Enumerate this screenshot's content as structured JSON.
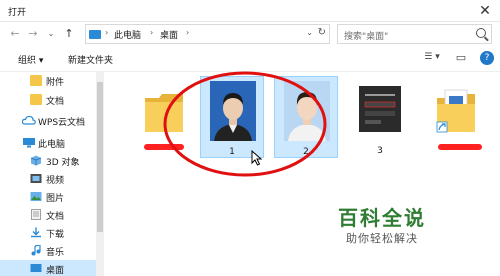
{
  "window": {
    "title": "打开",
    "close_glyph": "✕"
  },
  "nav": {
    "back": "←",
    "forward": "→",
    "dropdown": "⌄",
    "up": "↑"
  },
  "address": {
    "crumbs": [
      "此电脑",
      "桌面"
    ],
    "sep": "›",
    "dropdown": "⌄",
    "refresh": "↻"
  },
  "search": {
    "placeholder": "搜索\"桌面\""
  },
  "toolbar": {
    "organize": "组织 ▾",
    "new_folder": "新建文件夹",
    "view_glyph": "☰ ▾",
    "preview_glyph": "▭",
    "help_glyph": "?"
  },
  "sidebar": {
    "items": [
      {
        "label": "附件",
        "icon": "folder-icon"
      },
      {
        "label": "文档",
        "icon": "folder-icon"
      },
      {
        "label": "WPS云文档",
        "icon": "cloud-icon"
      },
      {
        "label": "此电脑",
        "icon": "pc-icon"
      },
      {
        "label": "3D 对象",
        "icon": "cube-icon"
      },
      {
        "label": "视频",
        "icon": "video-icon"
      },
      {
        "label": "图片",
        "icon": "picture-icon"
      },
      {
        "label": "文档",
        "icon": "document-icon"
      },
      {
        "label": "下载",
        "icon": "download-icon"
      },
      {
        "label": "音乐",
        "icon": "music-icon"
      },
      {
        "label": "桌面",
        "icon": "desktop-icon"
      }
    ]
  },
  "files": [
    {
      "name": "",
      "type": "folder"
    },
    {
      "name": "1",
      "type": "photo"
    },
    {
      "name": "2",
      "type": "photo"
    },
    {
      "name": "3",
      "type": "screenshot"
    },
    {
      "name": "",
      "type": "shortcut"
    }
  ],
  "watermark": {
    "brand": "百科全说",
    "slogan": "助你轻松解决"
  },
  "colors": {
    "accent": "#1f78c8",
    "selection": "#cce8ff",
    "annotation_red": "#e01010",
    "brand_green": "#2f7d32"
  }
}
